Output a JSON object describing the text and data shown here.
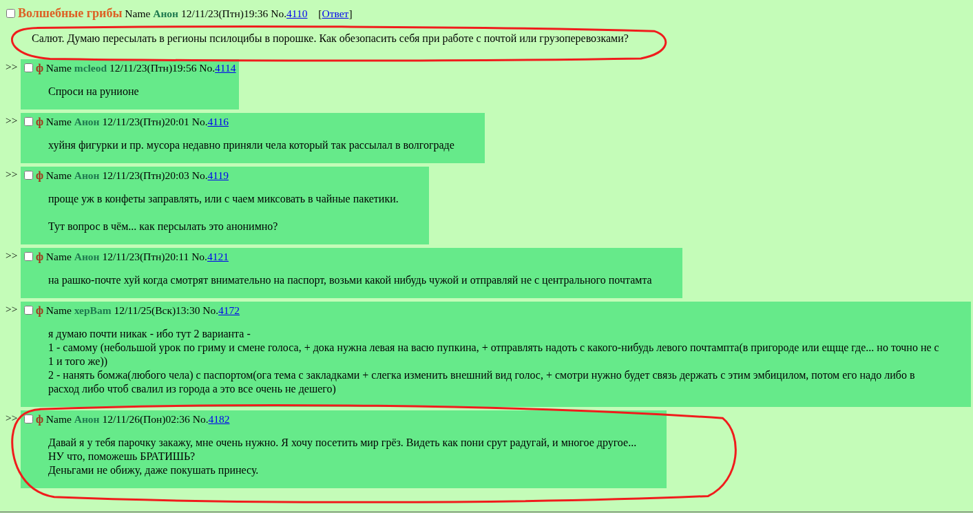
{
  "thread": {
    "op": {
      "checked": false,
      "subject": "Волшебные грибы",
      "name_label": "Name",
      "name": "Анон",
      "date": "12/11/23(Птн)19:36",
      "number_label": "No.",
      "number": "4110",
      "reply_link": {
        "open": "[",
        "label": "Ответ",
        "close": "]"
      },
      "message": [
        [
          "Салют. Думаю пересылать в регионы псилоцибы в порошке. Как обезопасить себя при работе с почтой или грузоперевозками?"
        ]
      ],
      "circled": true
    },
    "replies": [
      {
        "marker": ">>",
        "checked": false,
        "tag": "ф",
        "name_label": "Name",
        "name": "mcleod",
        "date": "12/11/23(Птн)19:56",
        "number_label": "No.",
        "number": "4114",
        "message": [
          [
            "Спроси на рунионе"
          ]
        ],
        "circled": false
      },
      {
        "marker": ">>",
        "checked": false,
        "tag": "ф",
        "name_label": "Name",
        "name": "Анон",
        "date": "12/11/23(Птн)20:01",
        "number_label": "No.",
        "number": "4116",
        "message": [
          [
            "хуйня фигурки и пр. мусора недавно приняли чела который так рассылал в волгограде"
          ]
        ],
        "circled": false
      },
      {
        "marker": ">>",
        "checked": false,
        "tag": "ф",
        "name_label": "Name",
        "name": "Анон",
        "date": "12/11/23(Птн)20:03",
        "number_label": "No.",
        "number": "4119",
        "message": [
          [
            "проще уж в конфеты заправлять, или с чаем миксовать в чайные пакетики."
          ],
          [
            "Тут вопрос в чём... как персылать это анонимно?"
          ]
        ],
        "circled": false
      },
      {
        "marker": ">>",
        "checked": false,
        "tag": "ф",
        "name_label": "Name",
        "name": "Анон",
        "date": "12/11/23(Птн)20:11",
        "number_label": "No.",
        "number": "4121",
        "message": [
          [
            "на рашко-почте хуй когда смотрят внимательно на паспорт, возьми какой нибудь чужой и отправляй не с центрального почтамта"
          ]
        ],
        "circled": false
      },
      {
        "marker": ">>",
        "checked": false,
        "tag": "ф",
        "name_label": "Name",
        "name": "херВam",
        "date": "12/11/25(Вск)13:30",
        "number_label": "No.",
        "number": "4172",
        "message": [
          [
            "я думаю почти никак - ибо тут 2 варианта -",
            "1 - самому (небольшой урок по гриму и смене голоса, + дока нужна левая на васю пупкина, + отправлять надоть с какого-нибудь левого почтампта(в пригороде или ещще где... но точно не с 1 и того же))",
            "2 - нанять бомжа(любого чела) с паспортом(ога тема с закладками + слегка изменить внешний вид голос, + смотри нужно будет связь держать с этим эмбицилом, потом его надо либо в расход либо чтоб свалил из города а это все очень не дешего)"
          ]
        ],
        "circled": false
      },
      {
        "marker": ">>",
        "checked": false,
        "tag": "ф",
        "name_label": "Name",
        "name": "Анон",
        "date": "12/11/26(Пон)02:36",
        "number_label": "No.",
        "number": "4182",
        "message": [
          [
            "Давай я у тебя парочку закажу, мне очень нужно. Я хочу посетить мир грёз. Видеть как пони срут радугай, и многое другое...",
            "НУ что, поможешь БРАТИШЬ?",
            "Деньгами не обижу, даже покушать принесу."
          ]
        ],
        "circled": true
      }
    ]
  }
}
